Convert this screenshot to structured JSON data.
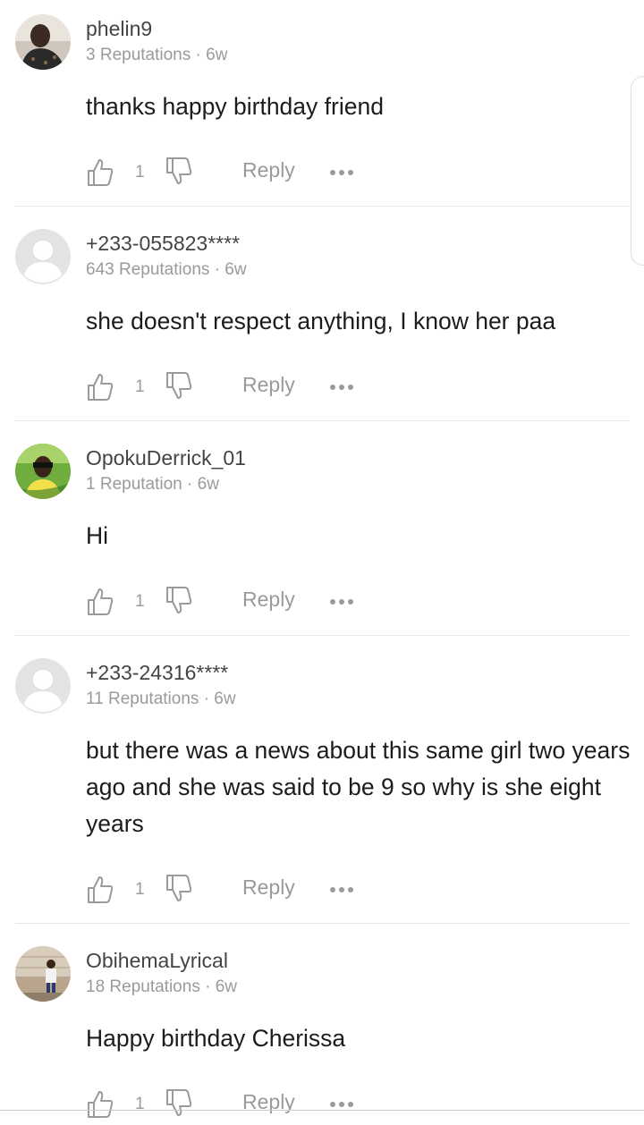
{
  "comments": [
    {
      "username": "phelin9",
      "reputation": "3 Reputations",
      "time": "6w",
      "text": "thanks happy birthday  friend",
      "likes": "1",
      "reply_label": "Reply",
      "avatar": "photo-avatar"
    },
    {
      "username": "+233-055823****",
      "reputation": "643 Reputations",
      "time": "6w",
      "text": "she doesn't respect anything, I know her paa",
      "likes": "1",
      "reply_label": "Reply",
      "avatar": "default-avatar"
    },
    {
      "username": "OpokuDerrick_01",
      "reputation": "1 Reputation",
      "time": "6w",
      "text": "Hi",
      "likes": "1",
      "reply_label": "Reply",
      "avatar": "photo-avatar"
    },
    {
      "username": "+233-24316****",
      "reputation": "11 Reputations",
      "time": "6w",
      "text": "but there was a news about this same girl two years ago and she was said to be 9 so why is she eight years",
      "likes": "1",
      "reply_label": "Reply",
      "avatar": "default-avatar"
    },
    {
      "username": "ObihemaLyrical",
      "reputation": "18 Reputations",
      "time": "6w",
      "text": "Happy birthday Cherissa",
      "likes": "1",
      "reply_label": "Reply",
      "avatar": "photo-avatar"
    }
  ],
  "colors": {
    "meta_gray": "#9a9a9a",
    "divider": "#e6e6e6",
    "placeholder_avatar": "#e3e3e3"
  }
}
